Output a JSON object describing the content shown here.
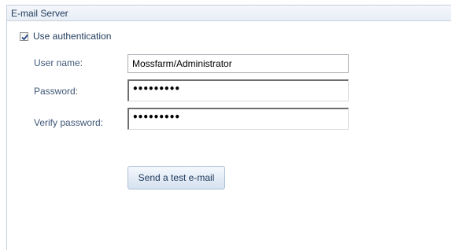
{
  "panel": {
    "title": "E-mail Server"
  },
  "auth": {
    "checked": true,
    "label": "Use authentication"
  },
  "fields": {
    "username": {
      "label": "User name:",
      "value": "Mossfarm/Administrator"
    },
    "password": {
      "label": "Password:",
      "value": "•••••••••"
    },
    "verify_password": {
      "label": "Verify password:",
      "value": "•••••••••"
    }
  },
  "actions": {
    "send_test_label": "Send a test e-mail"
  },
  "icons": {
    "checkbox_check": "check-icon"
  },
  "colors": {
    "label_text": "#3f5777",
    "header_bg": "#e8eef6",
    "border": "#c5cfdb",
    "check": "#2b4a8a"
  }
}
